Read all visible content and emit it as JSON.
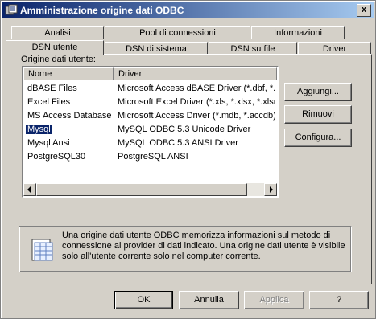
{
  "window": {
    "title": "Amministrazione origine dati ODBC",
    "close_glyph": "x"
  },
  "tabs_back": [
    {
      "label": "Analisi"
    },
    {
      "label": "Pool di connessioni"
    },
    {
      "label": "Informazioni"
    }
  ],
  "tabs_front": [
    {
      "label": "DSN utente",
      "active": true
    },
    {
      "label": "DSN di sistema"
    },
    {
      "label": "DSN su file"
    },
    {
      "label": "Driver"
    }
  ],
  "panel": {
    "list_label": "Origine dati utente:",
    "columns": [
      "Nome",
      "Driver"
    ],
    "rows": [
      {
        "name": "dBASE Files",
        "driver": "Microsoft Access dBASE Driver (*.dbf, *."
      },
      {
        "name": "Excel Files",
        "driver": "Microsoft Excel Driver (*.xls, *.xlsx, *.xlsm"
      },
      {
        "name": "MS Access Database",
        "driver": "Microsoft Access Driver (*.mdb, *.accdb)"
      },
      {
        "name": "Mysql",
        "driver": "MySQL ODBC 5.3 Unicode Driver",
        "selected": true
      },
      {
        "name": "Mysql Ansi",
        "driver": "MySQL ODBC 5.3 ANSI Driver"
      },
      {
        "name": "PostgreSQL30",
        "driver": "PostgreSQL ANSI"
      }
    ],
    "buttons": {
      "add": "Aggiungi...",
      "remove": "Rimuovi",
      "configure": "Configura..."
    },
    "info_text": "Una origine dati utente ODBC memorizza informazioni sul metodo di connessione al provider di dati indicato. Una origine dati utente è visibile solo all'utente corrente solo nel computer corrente."
  },
  "footer": {
    "ok": "OK",
    "cancel": "Annulla",
    "apply": "Applica",
    "help": "?"
  },
  "colors": {
    "title_start": "#0a246a",
    "title_end": "#a6caf0",
    "selection": "#0a246a",
    "face": "#d4d0c8"
  },
  "icons": [
    "odbc-app-icon",
    "close-icon",
    "scroll-left-icon",
    "scroll-right-icon",
    "data-source-info-icon"
  ]
}
